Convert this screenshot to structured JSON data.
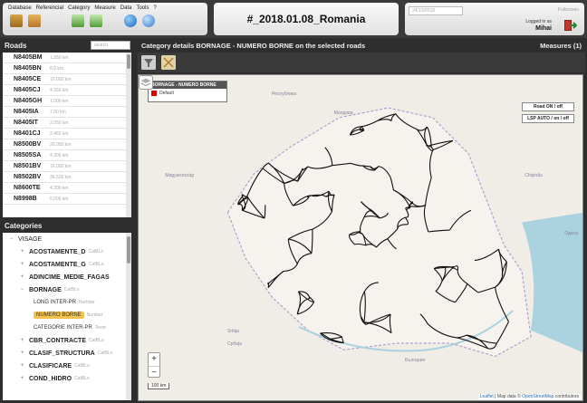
{
  "menu": {
    "items": [
      "Database",
      "Referencial",
      "Category",
      "Measure",
      "Data",
      "Tools",
      "?"
    ]
  },
  "toolbar": {
    "icons": [
      "database-icon",
      "export-icon",
      "add-page-icon",
      "forward-icon",
      "globe-icon",
      "globe-link-icon"
    ]
  },
  "header": {
    "title": "#_2018.01.08_Romania"
  },
  "user": {
    "date": "24/10/2018",
    "fullscreen": "Fullscreen",
    "logged_label": "Logged in as",
    "name": "Mihai"
  },
  "roads": {
    "title": "Roads",
    "search_placeholder": "search",
    "items": [
      {
        "code": "N8405BM",
        "length": "1.350 km"
      },
      {
        "code": "N8405BN",
        "length": "8.9 km"
      },
      {
        "code": "N8405CE",
        "length": "10.000 km"
      },
      {
        "code": "N8405CJ",
        "length": "4.550 km"
      },
      {
        "code": "N8405GH",
        "length": "1.000 km"
      },
      {
        "code": "N8405IA",
        "length": "7.00 km"
      },
      {
        "code": "N8405IT",
        "length": "2.050 km"
      },
      {
        "code": "N8401CJ",
        "length": "2.460 km"
      },
      {
        "code": "N8500BV",
        "length": "20.050 km"
      },
      {
        "code": "N8505SA",
        "length": "4.300 km"
      },
      {
        "code": "N8501BV",
        "length": "16.000 km"
      },
      {
        "code": "N8502BV",
        "length": "36.536 km"
      },
      {
        "code": "N8600TE",
        "length": "4.300 km"
      },
      {
        "code": "N8998B",
        "length": "5.000 km"
      }
    ]
  },
  "categories": {
    "title": "Categories",
    "tree": [
      {
        "label": "VISAGE",
        "bold": false,
        "depth": 0,
        "toggle": "−",
        "hint": ""
      },
      {
        "label": "ACOSTAMENTE_D",
        "bold": true,
        "depth": 1,
        "toggle": "+",
        "hint": "CatBLo"
      },
      {
        "label": "ACOSTAMENTE_G",
        "bold": true,
        "depth": 1,
        "toggle": "+",
        "hint": "CatBLo"
      },
      {
        "label": "ADINCIME_MEDIE_FAGAS",
        "bold": true,
        "depth": 1,
        "toggle": "+",
        "hint": ""
      },
      {
        "label": "BORNAGE",
        "bold": true,
        "depth": 1,
        "toggle": "−",
        "hint": "CatBLo"
      },
      {
        "label": "LONG INTER-PR",
        "bold": false,
        "depth": 2,
        "toggle": "",
        "hint": "Number"
      },
      {
        "label": "NUMERO BORNE",
        "bold": false,
        "depth": 2,
        "toggle": "",
        "hint": "Number",
        "selected": true
      },
      {
        "label": "CATEGORIE INTER-PR",
        "bold": false,
        "depth": 2,
        "toggle": "",
        "hint": "Texte"
      },
      {
        "label": "CBR_CONTRACTE",
        "bold": true,
        "depth": 1,
        "toggle": "+",
        "hint": "CatBLo"
      },
      {
        "label": "CLASIF_STRUCTURA",
        "bold": true,
        "depth": 1,
        "toggle": "+",
        "hint": "CatBLo"
      },
      {
        "label": "CLASIFICARE",
        "bold": true,
        "depth": 1,
        "toggle": "+",
        "hint": "CatBLo"
      },
      {
        "label": "COND_HIDRO",
        "bold": true,
        "depth": 1,
        "toggle": "+",
        "hint": "CatBLo"
      }
    ]
  },
  "details": {
    "title": "Category details BORNAGE - NUMERO BORNE on the selected roads",
    "measures": "Measures (1)"
  },
  "map": {
    "legend_title": "BORNAGE - NUMERO BORNE",
    "legend_item": "Default",
    "legend_color": "#dd0000",
    "road_toggle": "Road ON / off",
    "sdp_toggle": "LSP AUTO / on / off",
    "zoom_in": "+",
    "zoom_out": "−",
    "scale": "100 km",
    "attribution_leaflet": "Leaflet",
    "attribution_mid": " | Map data © ",
    "attribution_osm": "OpenStreetMap",
    "attribution_end": " contributors",
    "labels": [
      {
        "text": "Республика",
        "x": 30,
        "y": 5
      },
      {
        "text": "Молдова",
        "x": 44,
        "y": 11
      },
      {
        "text": "Magyarország",
        "x": 6,
        "y": 30
      },
      {
        "text": "Srbija",
        "x": 20,
        "y": 78
      },
      {
        "text": "Србија",
        "x": 20,
        "y": 82
      },
      {
        "text": "България",
        "x": 60,
        "y": 87
      },
      {
        "text": "Chișinău",
        "x": 87,
        "y": 30
      },
      {
        "text": "Одеса",
        "x": 96,
        "y": 48
      }
    ]
  }
}
